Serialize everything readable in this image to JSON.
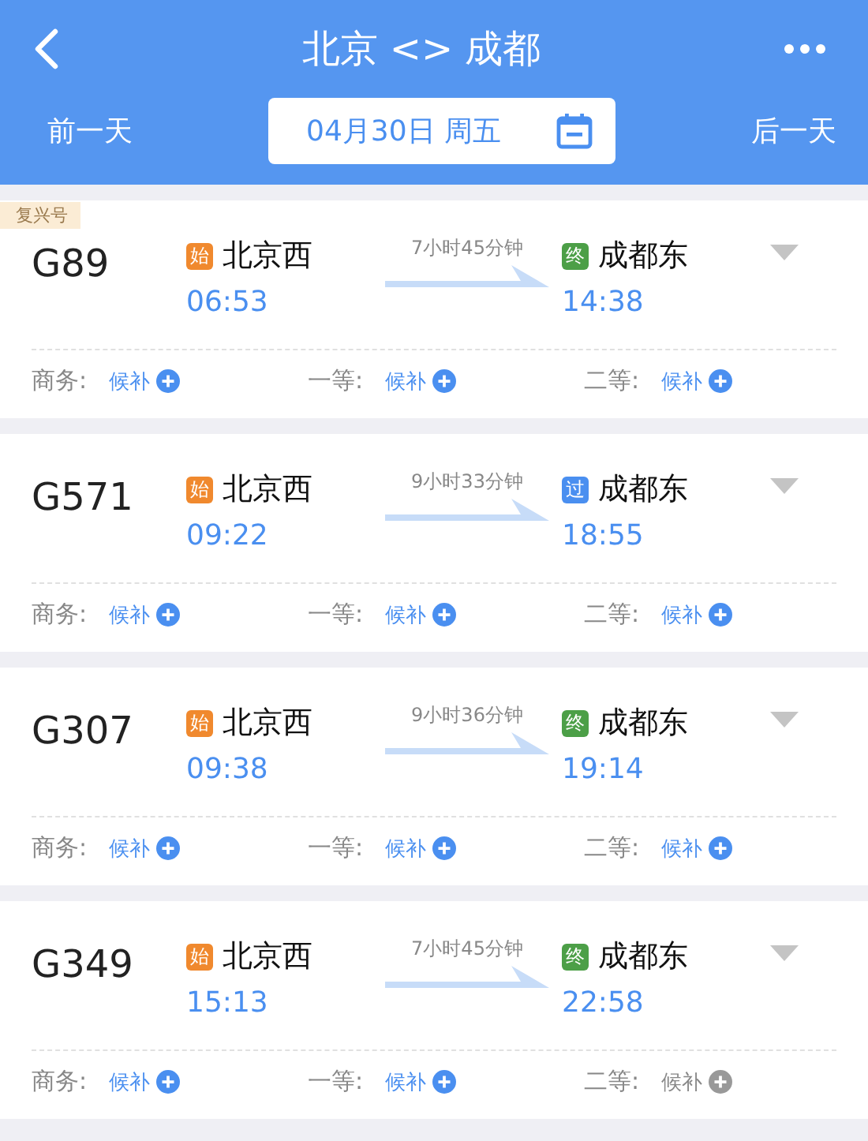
{
  "header": {
    "title": "北京 <> 成都",
    "prev_day": "前一天",
    "date": "04月30日 周五",
    "next_day": "后一天"
  },
  "trains": [
    {
      "brand": "复兴号",
      "number": "G89",
      "from": {
        "badge": "始",
        "color": "#f0892e",
        "name": "北京西",
        "time": "06:53"
      },
      "duration": "7小时45分钟",
      "to": {
        "badge": "终",
        "color": "#4c9f47",
        "name": "成都东",
        "time": "14:38"
      },
      "seats": [
        {
          "label": "商务:",
          "status": "候补",
          "disabled": false
        },
        {
          "label": "一等:",
          "status": "候补",
          "disabled": false
        },
        {
          "label": "二等:",
          "status": "候补",
          "disabled": false
        }
      ]
    },
    {
      "number": "G571",
      "from": {
        "badge": "始",
        "color": "#f0892e",
        "name": "北京西",
        "time": "09:22"
      },
      "duration": "9小时33分钟",
      "to": {
        "badge": "过",
        "color": "#4a8ff0",
        "name": "成都东",
        "time": "18:55"
      },
      "seats": [
        {
          "label": "商务:",
          "status": "候补",
          "disabled": false
        },
        {
          "label": "一等:",
          "status": "候补",
          "disabled": false
        },
        {
          "label": "二等:",
          "status": "候补",
          "disabled": false
        }
      ]
    },
    {
      "number": "G307",
      "from": {
        "badge": "始",
        "color": "#f0892e",
        "name": "北京西",
        "time": "09:38"
      },
      "duration": "9小时36分钟",
      "to": {
        "badge": "终",
        "color": "#4c9f47",
        "name": "成都东",
        "time": "19:14"
      },
      "seats": [
        {
          "label": "商务:",
          "status": "候补",
          "disabled": false
        },
        {
          "label": "一等:",
          "status": "候补",
          "disabled": false
        },
        {
          "label": "二等:",
          "status": "候补",
          "disabled": false
        }
      ]
    },
    {
      "number": "G349",
      "from": {
        "badge": "始",
        "color": "#f0892e",
        "name": "北京西",
        "time": "15:13"
      },
      "duration": "7小时45分钟",
      "to": {
        "badge": "终",
        "color": "#4c9f47",
        "name": "成都东",
        "time": "22:58"
      },
      "seats": [
        {
          "label": "商务:",
          "status": "候补",
          "disabled": false
        },
        {
          "label": "一等:",
          "status": "候补",
          "disabled": false
        },
        {
          "label": "二等:",
          "status": "候补",
          "disabled": true
        }
      ]
    }
  ]
}
